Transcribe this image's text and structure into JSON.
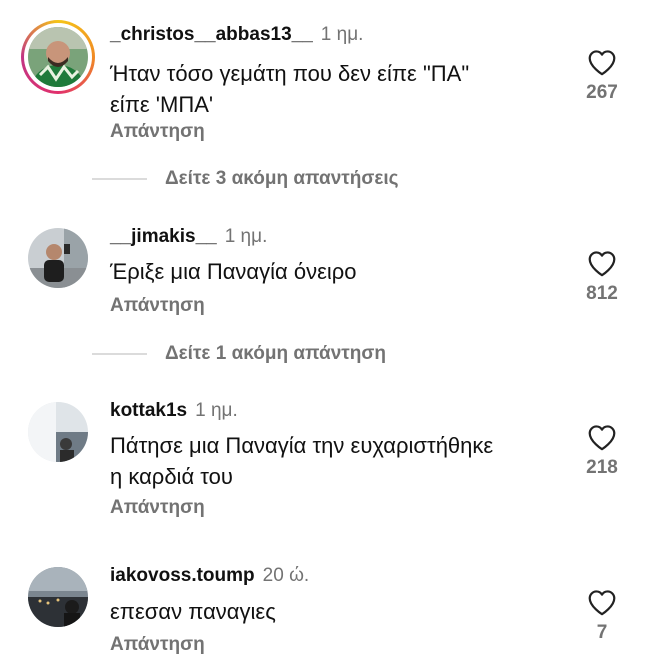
{
  "comments": [
    {
      "username": "_christos__abbas13__",
      "time": "1 ημ.",
      "text_lines": [
        "Ήταν τόσο γεμάτη που δεν είπε \"ΠΑ\"",
        "είπε 'ΜΠΑ'"
      ],
      "likes": "267",
      "reply_label": "Απάντηση",
      "has_story_ring": true
    },
    {
      "username": "__jimakis__",
      "time": "1 ημ.",
      "text_lines": [
        "Έριξε μια Παναγία όνειρο"
      ],
      "likes": "812",
      "reply_label": "Απάντηση",
      "has_story_ring": false
    },
    {
      "username": "kottak1s",
      "time": "1 ημ.",
      "text_lines": [
        "Πάτησε μια Παναγία την ευχαριστήθηκε",
        "η καρδιά του"
      ],
      "likes": "218",
      "reply_label": "Απάντηση",
      "has_story_ring": false
    },
    {
      "username": "iakovoss.toump",
      "time": "20 ώ.",
      "text_lines": [
        "επεσαν παναγιες"
      ],
      "likes": "7",
      "reply_label": "Απάντηση",
      "has_story_ring": false
    }
  ],
  "view_more": [
    {
      "label": "Δείτε 3 ακόμη απαντήσεις"
    },
    {
      "label": "Δείτε 1 ακόμη απάντηση"
    }
  ],
  "colors": {
    "secondary_text": "#737373",
    "divider": "#dbdbdb"
  },
  "icons": {
    "like": "heart-outline-icon"
  }
}
